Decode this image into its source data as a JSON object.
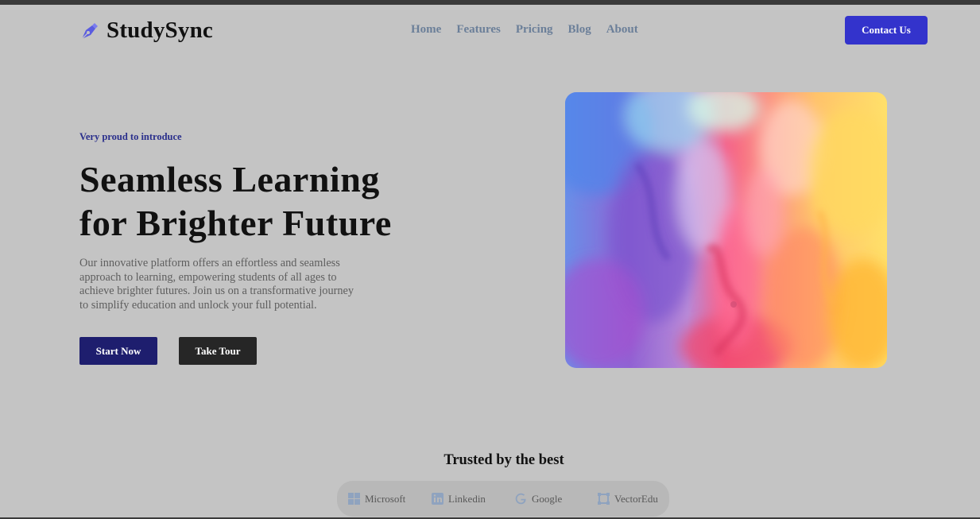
{
  "header": {
    "brand": "StudySync",
    "nav": [
      "Home",
      "Features",
      "Pricing",
      "Blog",
      "About"
    ],
    "contact_label": "Contact Us"
  },
  "hero": {
    "eyebrow": "Very proud to introduce",
    "headline_line1": "Seamless Learning",
    "headline_line2": "for Brighter Future",
    "description": "Our innovative platform offers an effortless and seamless approach to learning, empowering students of all ages to achieve brighter futures. Join us on a transformative journey to simplify education and unlock your full potential.",
    "start_label": "Start Now",
    "tour_label": "Take Tour"
  },
  "trusted": {
    "title": "Trusted by the best",
    "logos": [
      "Microsoft",
      "Linkedin",
      "Google",
      "VectorEdu"
    ]
  },
  "colors": {
    "background": "#c4c4c4",
    "accent": "#3333cc",
    "start_button": "#1e1e6e",
    "tour_button": "#262626",
    "nav_text": "#6b7f99"
  },
  "icons": {
    "brand": "pen-nib-icon",
    "logos": [
      "microsoft-icon",
      "linkedin-icon",
      "google-icon",
      "vectoredu-icon"
    ]
  }
}
